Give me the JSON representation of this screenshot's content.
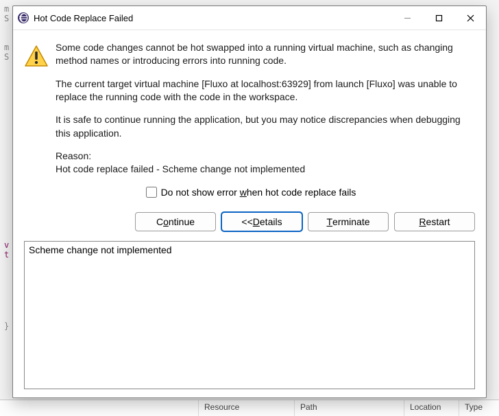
{
  "background": {
    "columns": {
      "resource": "Resource",
      "path": "Path",
      "location": "Location",
      "type": "Type"
    }
  },
  "titlebar": {
    "title": "Hot Code Replace Failed"
  },
  "message": {
    "para1": "Some code changes cannot be hot swapped into a running virtual machine, such as changing method names or introducing errors into running code.",
    "para2": "The current target virtual machine [Fluxo at localhost:63929] from launch [Fluxo] was unable to replace the running code with the code in the workspace.",
    "para3": "It is safe to continue running the application, but you may notice discrepancies when debugging this application.",
    "reason_label": "Reason:",
    "reason_body": "Hot code replace failed - Scheme change not implemented"
  },
  "checkbox": {
    "pre": "Do not show error ",
    "mnemonic": "w",
    "post": "hen hot code replace fails"
  },
  "buttons": {
    "continue_pre": "C",
    "continue_u": "o",
    "continue_post": "ntinue",
    "details_pre": "<< ",
    "details_u": "D",
    "details_post": "etails",
    "terminate_pre": "",
    "terminate_u": "T",
    "terminate_post": "erminate",
    "restart_pre": "",
    "restart_u": "R",
    "restart_post": "estart"
  },
  "details_text": "Scheme change not implemented"
}
